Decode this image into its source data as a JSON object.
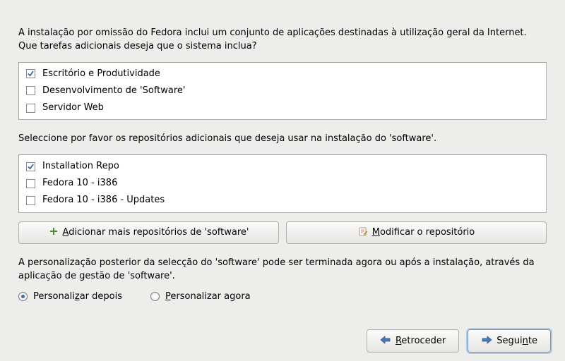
{
  "intro": "A instalação por omissão do Fedora inclui um conjunto de aplicações destinadas à utilização geral da Internet. Que tarefas adicionais deseja que o sistema inclua?",
  "tasks": [
    {
      "label": "Escritório e Produtividade",
      "checked": true
    },
    {
      "label": "Desenvolvimento de 'Software'",
      "checked": false
    },
    {
      "label": "Servidor Web",
      "checked": false
    }
  ],
  "repo_intro": "Seleccione por favor os repositórios adicionais que deseja usar na instalação do 'software'.",
  "repos": [
    {
      "label": "Installation Repo",
      "checked": true
    },
    {
      "label": "Fedora 10 - i386",
      "checked": false
    },
    {
      "label": "Fedora 10 - i386 - Updates",
      "checked": false
    }
  ],
  "buttons": {
    "add_pre": "A",
    "add_rest": "dicionar mais repositórios de 'software'",
    "mod_pre": "M",
    "mod_rest": "odificar o repositório"
  },
  "customize_intro": "A personalização posterior da selecção do 'software' pode ser terminada agora ou após a instalação, através da aplicação de gestão de 'software'.",
  "radios": {
    "later_pre": "Personali",
    "later_u": "z",
    "later_rest": "ar depois",
    "now_pre": "P",
    "now_rest": "ersonalizar agora",
    "selected": "later"
  },
  "nav": {
    "back_pre": "R",
    "back_rest": "etroceder",
    "next_pre": "Segui",
    "next_u": "n",
    "next_rest": "te"
  }
}
